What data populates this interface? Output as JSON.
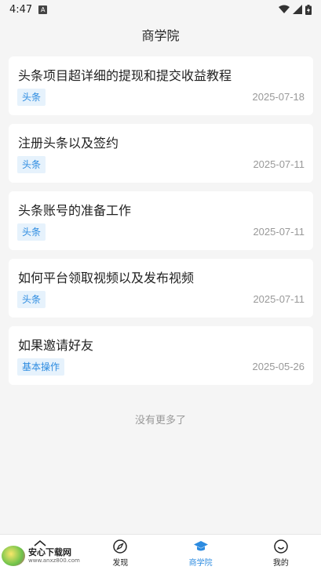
{
  "status_bar": {
    "time": "4:47",
    "notification_icon": "A"
  },
  "header": {
    "title": "商学院"
  },
  "articles": [
    {
      "title": "头条项目超详细的提现和提交收益教程",
      "tag": "头条",
      "date": "2025-07-18"
    },
    {
      "title": "注册头条以及签约",
      "tag": "头条",
      "date": "2025-07-11"
    },
    {
      "title": "头条账号的准备工作",
      "tag": "头条",
      "date": "2025-07-11"
    },
    {
      "title": "如何平台领取视频以及发布视频",
      "tag": "头条",
      "date": "2025-07-11"
    },
    {
      "title": "如果邀请好友",
      "tag": "基本操作",
      "date": "2025-05-26"
    }
  ],
  "list_end_text": "没有更多了",
  "tabbar": {
    "tabs": [
      {
        "label": "",
        "icon": "home-icon"
      },
      {
        "label": "发现",
        "icon": "compass-icon"
      },
      {
        "label": "商学院",
        "icon": "graduation-cap-icon"
      },
      {
        "label": "我的",
        "icon": "smile-icon"
      }
    ],
    "active_index": 2
  },
  "watermark": {
    "title": "安心下载网",
    "url": "www.anxz800.com"
  },
  "colors": {
    "accent": "#2c8be0",
    "tag_bg": "#e6f2fc",
    "background": "#f5f5f5"
  }
}
